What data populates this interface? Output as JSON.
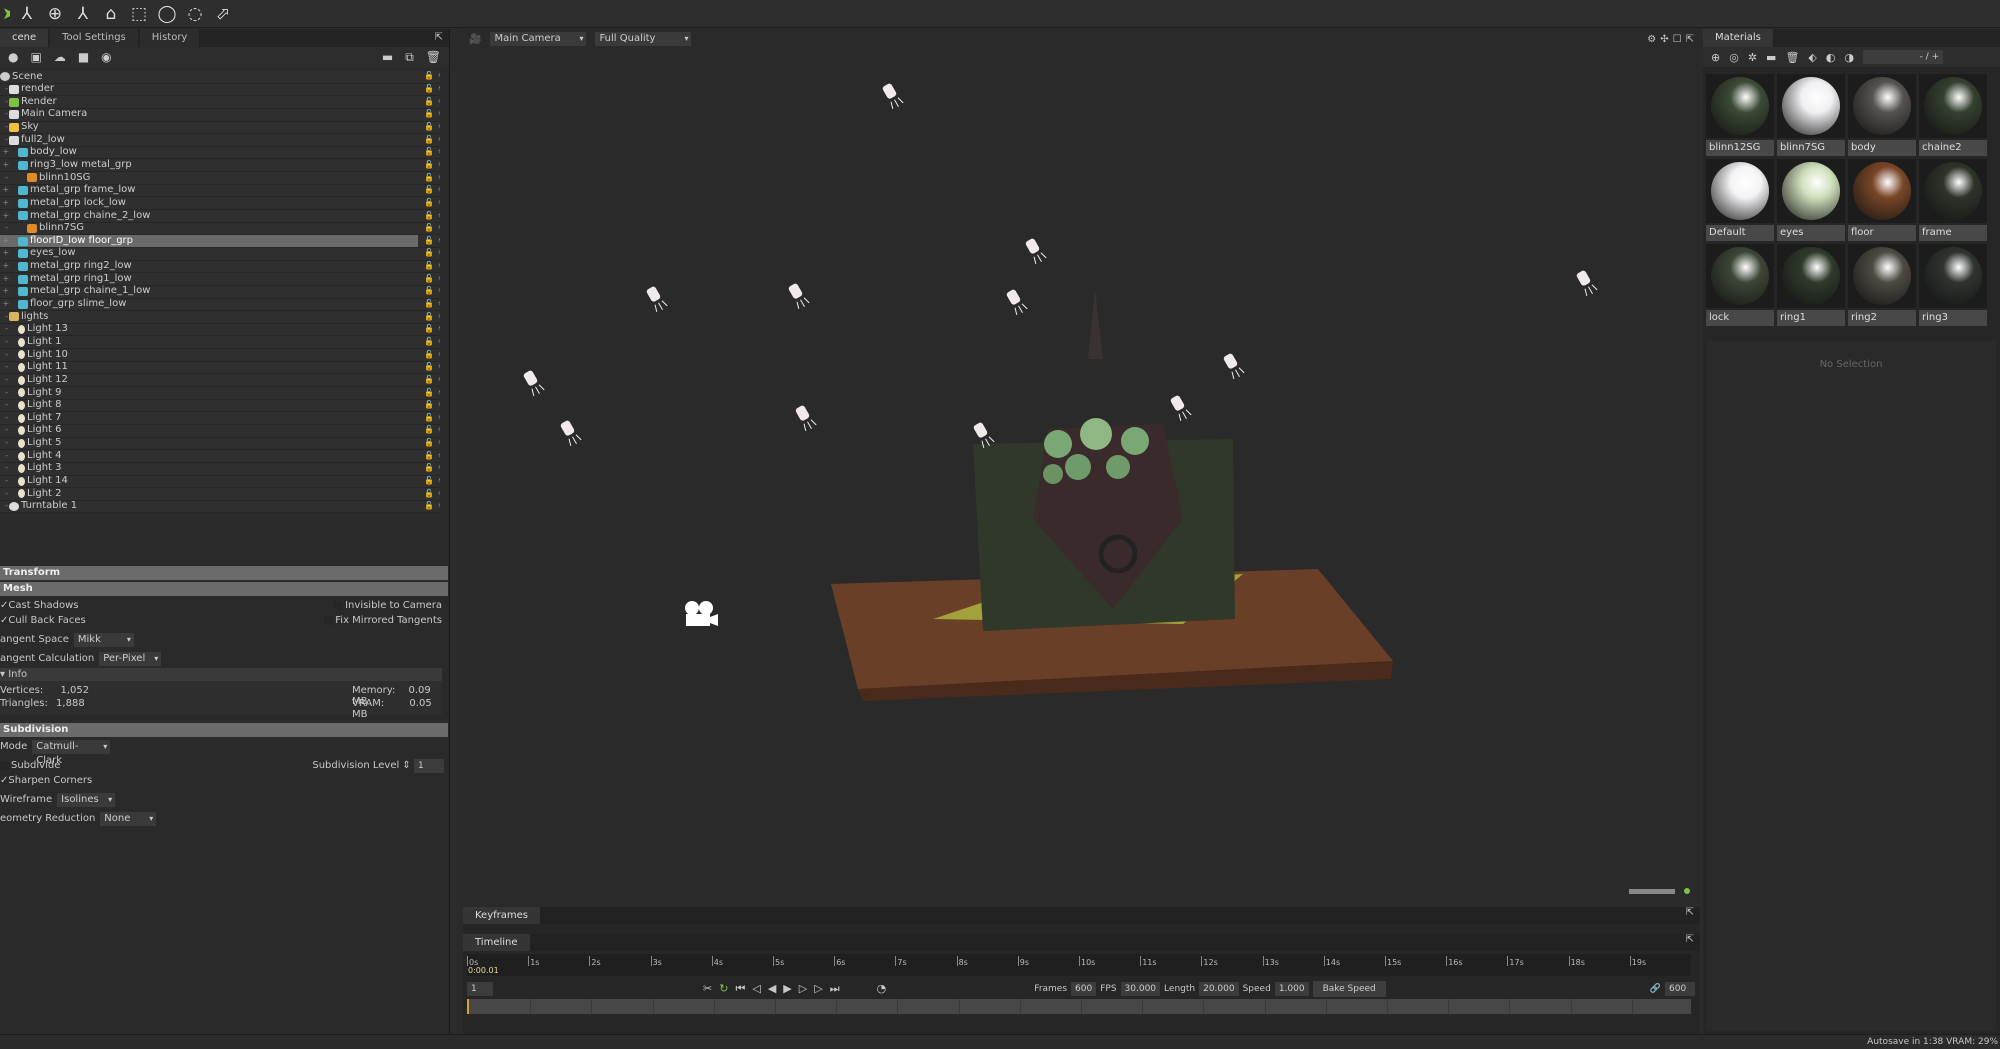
{
  "toolbar": {
    "tools": [
      "select-arrow-icon",
      "move-gizmo-icon",
      "rotate-gizmo-icon",
      "scale-gizmo-icon",
      "turntable-icon",
      "rect-select-icon",
      "ellipse-select-icon",
      "lasso-select-icon",
      "polygon-select-icon"
    ]
  },
  "left_tabs": [
    "cene",
    "Tool Settings",
    "History"
  ],
  "scene_tree": [
    {
      "label": "Scene",
      "level": 0,
      "icon": "scene"
    },
    {
      "label": "render",
      "level": 1,
      "icon": "camera"
    },
    {
      "label": "Render",
      "level": 1,
      "icon": "gear"
    },
    {
      "label": "Main Camera",
      "level": 1,
      "icon": "camera"
    },
    {
      "label": "Sky",
      "level": 1,
      "icon": "sky"
    },
    {
      "label": "full2_low",
      "level": 1,
      "icon": "group"
    },
    {
      "label": "body_low",
      "level": 2,
      "icon": "mesh"
    },
    {
      "label": "ring3_low metal_grp",
      "level": 2,
      "icon": "mesh"
    },
    {
      "label": "blinn10SG",
      "level": 3,
      "icon": "material"
    },
    {
      "label": "metal_grp frame_low",
      "level": 2,
      "icon": "mesh"
    },
    {
      "label": "metal_grp lock_low",
      "level": 2,
      "icon": "mesh"
    },
    {
      "label": "metal_grp chaine_2_low",
      "level": 2,
      "icon": "mesh"
    },
    {
      "label": "blinn7SG",
      "level": 3,
      "icon": "material"
    },
    {
      "label": "floorID_low floor_grp",
      "level": 2,
      "icon": "mesh",
      "selected": true
    },
    {
      "label": "eyes_low",
      "level": 2,
      "icon": "mesh"
    },
    {
      "label": "metal_grp ring2_low",
      "level": 2,
      "icon": "mesh"
    },
    {
      "label": "metal_grp ring1_low",
      "level": 2,
      "icon": "mesh"
    },
    {
      "label": "metal_grp chaine_1_low",
      "level": 2,
      "icon": "mesh"
    },
    {
      "label": "floor_grp slime_low",
      "level": 2,
      "icon": "mesh"
    },
    {
      "label": "lights",
      "level": 1,
      "icon": "folder"
    },
    {
      "label": "Light 13",
      "level": 2,
      "icon": "light"
    },
    {
      "label": "Light 1",
      "level": 2,
      "icon": "light"
    },
    {
      "label": "Light 10",
      "level": 2,
      "icon": "light"
    },
    {
      "label": "Light 11",
      "level": 2,
      "icon": "light"
    },
    {
      "label": "Light 12",
      "level": 2,
      "icon": "light"
    },
    {
      "label": "Light 9",
      "level": 2,
      "icon": "light"
    },
    {
      "label": "Light 8",
      "level": 2,
      "icon": "light"
    },
    {
      "label": "Light 7",
      "level": 2,
      "icon": "light"
    },
    {
      "label": "Light 6",
      "level": 2,
      "icon": "light"
    },
    {
      "label": "Light 5",
      "level": 2,
      "icon": "light"
    },
    {
      "label": "Light 4",
      "level": 2,
      "icon": "light"
    },
    {
      "label": "Light 3",
      "level": 2,
      "icon": "light"
    },
    {
      "label": "Light 14",
      "level": 2,
      "icon": "light"
    },
    {
      "label": "Light 2",
      "level": 2,
      "icon": "light"
    },
    {
      "label": "Turntable 1",
      "level": 1,
      "icon": "turntable"
    }
  ],
  "props": {
    "transform": "Transform",
    "mesh": "Mesh",
    "cast_shadows": "Cast Shadows",
    "cull_back": "Cull Back Faces",
    "invisible": "Invisible to Camera",
    "fix_mirrored": "Fix Mirrored Tangents",
    "tangent_space_label": "angent Space",
    "tangent_space": "Mikk",
    "tangent_calc_label": "angent Calculation",
    "tangent_calc": "Per-Pixel",
    "info": "Info",
    "vertices_label": "Vertices:",
    "vertices": "1,052",
    "triangles_label": "Triangles:",
    "triangles": "1,888",
    "memory_label": "Memory:",
    "memory": "0.09 MB",
    "vram_label": "VRAM:",
    "vram": "0.05 MB",
    "subdivision": "Subdivision",
    "mode_label": "Mode",
    "mode": "Catmull-Clark",
    "subdivide": "Subdivide",
    "subdiv_level_label": "Subdivision Level",
    "subdiv_level": "1",
    "sharpen": "Sharpen Corners",
    "wireframe_label": "Wireframe",
    "wireframe": "Isolines",
    "geo_red_label": "eometry Reduction",
    "geo_red": "None"
  },
  "viewport": {
    "camera": "Main Camera",
    "quality": "Full Quality"
  },
  "materials": {
    "tab": "Materials",
    "zoom": "- / +",
    "no_selection": "No Selection",
    "items": [
      {
        "name": "blinn12SG",
        "color": "#3b4a35"
      },
      {
        "name": "blinn7SG",
        "color": "#f0f0f2"
      },
      {
        "name": "body",
        "color": "#55524f"
      },
      {
        "name": "chaine2",
        "color": "#34402f"
      },
      {
        "name": "Default",
        "color": "#f4f4f6"
      },
      {
        "name": "eyes",
        "color": "#cfe0bc"
      },
      {
        "name": "floor",
        "color": "#7a4628"
      },
      {
        "name": "frame",
        "color": "#2e342a"
      },
      {
        "name": "lock",
        "color": "#3c4636"
      },
      {
        "name": "ring1",
        "color": "#2f3a2a"
      },
      {
        "name": "ring2",
        "color": "#4d4a42"
      },
      {
        "name": "ring3",
        "color": "#2f3430"
      }
    ]
  },
  "timeline": {
    "keyframes_tab": "Keyframes",
    "timeline_tab": "Timeline",
    "ticks": [
      "0s",
      "1s",
      "2s",
      "3s",
      "4s",
      "5s",
      "6s",
      "7s",
      "8s",
      "9s",
      "10s",
      "11s",
      "12s",
      "13s",
      "14s",
      "15s",
      "16s",
      "17s",
      "18s",
      "19s"
    ],
    "current_time": "0:00.01",
    "frame": "1",
    "frames_label": "Frames",
    "frames": "600",
    "fps_label": "FPS",
    "fps": "30.000",
    "length_label": "Length",
    "length": "20.000",
    "speed_label": "Speed",
    "speed": "1.000",
    "bake": "Bake Speed",
    "end_frame": "600"
  },
  "status": "Autosave in 1:38   VRAM: 29%",
  "colors": {
    "accent_green": "#7dc242",
    "selection": "#6a6a6a",
    "playhead": "#d4a630"
  }
}
